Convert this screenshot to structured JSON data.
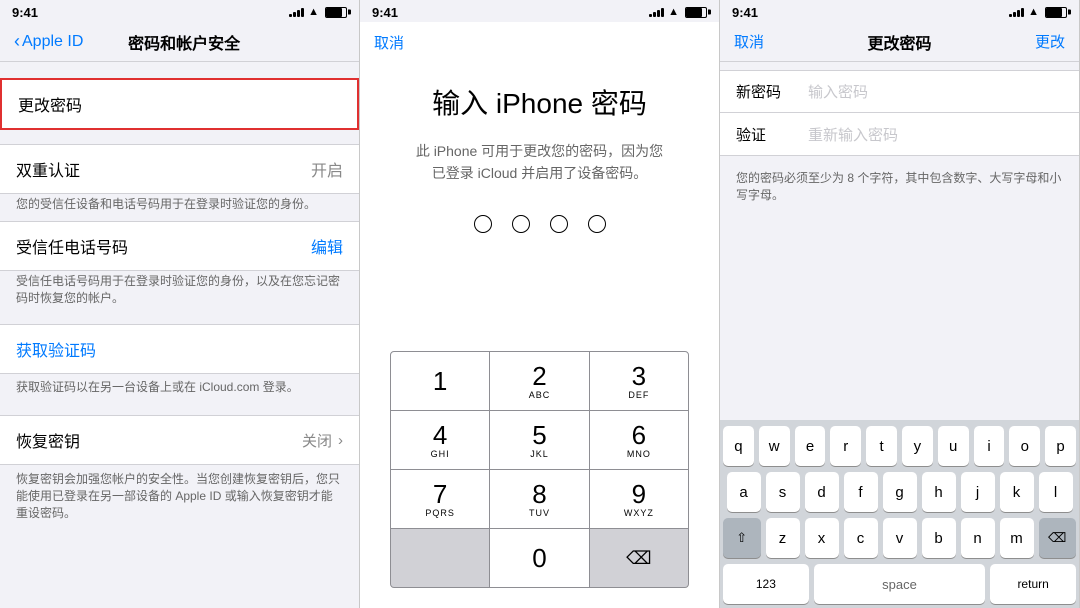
{
  "panel1": {
    "statusBar": {
      "time": "9:41"
    },
    "navBack": "Apple ID",
    "navTitle": "密码和帐户安全",
    "changePassword": "更改密码",
    "twoFactorSection": "双重认证",
    "twoFactorValue": "开启",
    "twoFactorDesc1": "您的受信任设备和电话号码用于在登录时验证您的身份。",
    "trustedPhone": "受信任电话号码",
    "trustedPhoneEdit": "编辑",
    "trustedPhoneDesc": "受信任电话号码用于在登录时验证您的身份，以及在您忘记密码时恢复您的帐户。",
    "getCodeLink": "获取验证码",
    "getCodeDesc": "获取验证码以在另一台设备上或在 iCloud.com 登录。",
    "recoveryKey": "恢复密钥",
    "recoveryKeyValue": "关闭",
    "recoveryKeyDesc": "恢复密钥会加强您帐户的安全性。当您创建恢复密钥后，您只能使用已登录在另一部设备的 Apple ID 或输入恢复密钥才能重设密码。"
  },
  "panel2": {
    "statusBar": {
      "time": "9:41"
    },
    "navCancel": "取消",
    "title": "输入 iPhone 密码",
    "desc": "此 iPhone 可用于更改您的密码，因为您已登录 iCloud 并启用了设备密码。",
    "numpad": [
      {
        "num": "1",
        "letters": ""
      },
      {
        "num": "2",
        "letters": "ABC"
      },
      {
        "num": "3",
        "letters": "DEF"
      },
      {
        "num": "4",
        "letters": "GHI"
      },
      {
        "num": "5",
        "letters": "JKL"
      },
      {
        "num": "6",
        "letters": "MNO"
      },
      {
        "num": "7",
        "letters": "PQRS"
      },
      {
        "num": "8",
        "letters": "TUV"
      },
      {
        "num": "9",
        "letters": "WXYZ"
      },
      {
        "num": "",
        "letters": ""
      },
      {
        "num": "0",
        "letters": ""
      },
      {
        "num": "⌫",
        "letters": ""
      }
    ]
  },
  "panel3": {
    "statusBar": {
      "time": "9:41"
    },
    "navCancel": "取消",
    "navTitle": "更改密码",
    "navDone": "更改",
    "newPasswordLabel": "新密码",
    "newPasswordPlaceholder": "输入密码",
    "verifyLabel": "验证",
    "verifyPlaceholder": "重新输入密码",
    "hint": "您的密码必须至少为 8 个字符，其中包含数字、大写字母和小写字母。",
    "keyboard": {
      "row1": [
        "q",
        "w",
        "e",
        "r",
        "t",
        "y",
        "u",
        "i",
        "o",
        "p"
      ],
      "row2": [
        "a",
        "s",
        "d",
        "f",
        "g",
        "h",
        "j",
        "k",
        "l"
      ],
      "row3": [
        "z",
        "x",
        "c",
        "v",
        "b",
        "n",
        "m"
      ]
    }
  }
}
